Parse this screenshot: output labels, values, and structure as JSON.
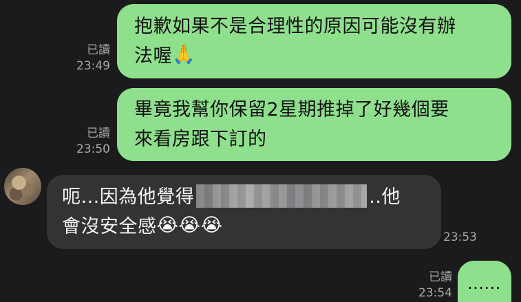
{
  "chat": {
    "messages": [
      {
        "direction": "sent",
        "status": "已讀",
        "time": "23:49",
        "lines": [
          "抱歉如果不是合理性的原因可能沒有辦",
          "法喔"
        ],
        "emoji": "🙏"
      },
      {
        "direction": "sent",
        "status": "已讀",
        "time": "23:50",
        "lines": [
          "畢竟我幫你保留2星期推掉了好幾個要",
          "來看房跟下訂的"
        ]
      },
      {
        "direction": "received",
        "time": "23:53",
        "line1_start": "呃...因為他覺得",
        "line1_end": "..他",
        "line2": "會沒安全感",
        "emoji": "😭😭😭"
      },
      {
        "direction": "sent",
        "status": "已讀",
        "time": "23:54",
        "text": "......"
      }
    ]
  },
  "colors": {
    "background": "#1b1b1d",
    "sent_bubble": "#8fe08d",
    "received_bubble": "#333335",
    "meta_text": "#a8a8a8"
  }
}
